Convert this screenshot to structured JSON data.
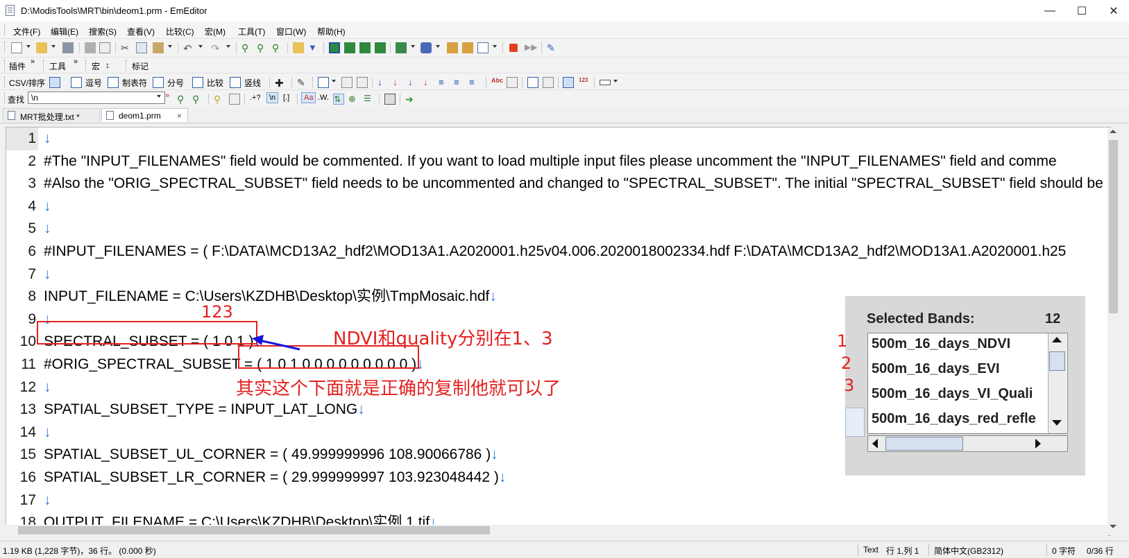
{
  "window": {
    "title": "D:\\ModisTools\\MRT\\bin\\deom1.prm - EmEditor",
    "minimize": "—",
    "maximize": "☐",
    "close": "✕"
  },
  "menu": [
    "文件(F)",
    "编辑(E)",
    "搜索(S)",
    "查看(V)",
    "比较(C)",
    "宏(M)",
    "工具(T)",
    "窗口(W)",
    "帮助(H)"
  ],
  "toolbar2": {
    "plugins": "插件",
    "tools": "工具",
    "macro": "宏",
    "macro_sep": "↕",
    "markers": "标记",
    "chevron": "»"
  },
  "toolbar3": {
    "csv": "CSV/排序",
    "comma": "逗号",
    "tab": "制表符",
    "semicolon": "分号",
    "compare": "比较",
    "pipe": "竖线"
  },
  "toolbar4": {
    "find_label": "查找",
    "find_value": "\\n",
    "regex_dot": ".+?",
    "escape_n": "\\n",
    "bracket": "[.]",
    "case_a": "Aa",
    "word_w": ".W."
  },
  "tabs": [
    {
      "label": "MRT批处理.txt *"
    },
    {
      "label": "deom1.prm",
      "close": "×"
    }
  ],
  "editor": {
    "lines": [
      {
        "n": "1",
        "text": "",
        "eol": "↓"
      },
      {
        "n": "2",
        "text": "#The \"INPUT_FILENAMES\" field would be commented. If you want to load multiple input files please uncomment the \"INPUT_FILENAMES\" field and comme",
        "eol": ""
      },
      {
        "n": "3",
        "text": "#Also the \"ORIG_SPECTRAL_SUBSET\" field needs to be uncommented and changed to \"SPECTRAL_SUBSET\". The initial \"SPECTRAL_SUBSET\" field should be",
        "eol": ""
      },
      {
        "n": "4",
        "text": "",
        "eol": "↓"
      },
      {
        "n": "5",
        "text": "",
        "eol": "↓"
      },
      {
        "n": "6",
        "text": "#INPUT_FILENAMES = ( F:\\DATA\\MCD13A2_hdf2\\MOD13A1.A2020001.h25v04.006.2020018002334.hdf F:\\DATA\\MCD13A2_hdf2\\MOD13A1.A2020001.h25",
        "eol": ""
      },
      {
        "n": "7",
        "text": "",
        "eol": "↓"
      },
      {
        "n": "8",
        "text": "INPUT_FILENAME = C:\\Users\\KZDHB\\Desktop\\实例\\TmpMosaic.hdf",
        "eol": "↓"
      },
      {
        "n": "9",
        "text": "",
        "eol": "↓"
      },
      {
        "n": "10",
        "text": "SPECTRAL_SUBSET = ( 1 0 1 )",
        "eol": "↓"
      },
      {
        "n": "11",
        "text": "#ORIG_SPECTRAL_SUBSET = ( 1 0 1 0 0 0 0 0 0 0 0 0 )",
        "eol": "↓"
      },
      {
        "n": "12",
        "text": "",
        "eol": "↓"
      },
      {
        "n": "13",
        "text": "SPATIAL_SUBSET_TYPE = INPUT_LAT_LONG",
        "eol": "↓"
      },
      {
        "n": "14",
        "text": "",
        "eol": "↓"
      },
      {
        "n": "15",
        "text": "SPATIAL_SUBSET_UL_CORNER = ( 49.999999996 108.90066786 )",
        "eol": "↓"
      },
      {
        "n": "16",
        "text": "SPATIAL_SUBSET_LR_CORNER = ( 29.999999997 103.923048442 )",
        "eol": "↓"
      },
      {
        "n": "17",
        "text": "",
        "eol": "↓"
      },
      {
        "n": "18",
        "text": "OUTPUT_FILENAME = C:\\Users\\KZDHB\\Desktop\\实例 1.tif",
        "eol": "↓"
      }
    ]
  },
  "annotations": {
    "label_123": "123",
    "note_ndvi": "NDVI和quality分别在1、3",
    "note_copy": "其实这个下面就是正确的复制他就可以了",
    "num1": "1",
    "num2": "2",
    "num3": "3"
  },
  "panel": {
    "title": "Selected Bands:",
    "count": "12",
    "bands": [
      "500m_16_days_NDVI",
      "500m_16_days_EVI",
      "500m_16_days_VI_Quali",
      "500m_16_days_red_refle"
    ]
  },
  "statusbar": {
    "size": "1.19 KB (1,228 字节)，36 行。 (0.000 秒)",
    "mode": "Text",
    "position": "行 1,列 1",
    "encoding": "简体中文(GB2312)",
    "chars": "0 字符",
    "lines": "0/36 行"
  },
  "colors": {
    "annotation_red": "#e32020",
    "eol_blue": "#2a7be4",
    "arrow_blue": "#1515e0"
  }
}
